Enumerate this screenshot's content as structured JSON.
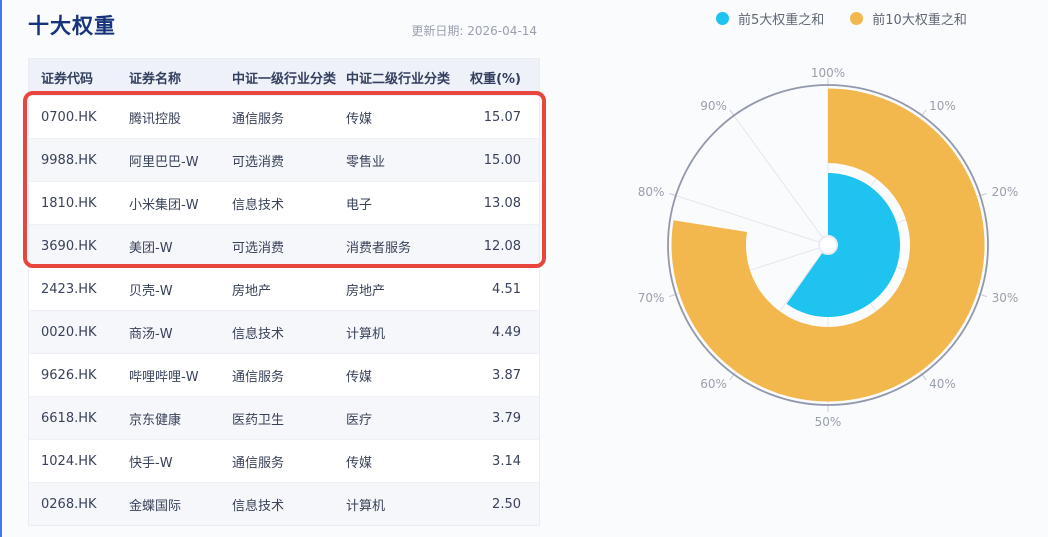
{
  "page": {
    "accent_color": "#4376f0",
    "background": "#fafbfd"
  },
  "header": {
    "title": "十大权重",
    "update_label": "更新日期: 2026-04-14"
  },
  "table": {
    "columns": [
      "证券代码",
      "证券名称",
      "中证一级行业分类",
      "中证二级行业分类",
      "权重(%)"
    ],
    "rows": [
      [
        "0700.HK",
        "腾讯控股",
        "通信服务",
        "传媒",
        "15.07"
      ],
      [
        "9988.HK",
        "阿里巴巴-W",
        "可选消费",
        "零售业",
        "15.00"
      ],
      [
        "1810.HK",
        "小米集团-W",
        "信息技术",
        "电子",
        "13.08"
      ],
      [
        "3690.HK",
        "美团-W",
        "可选消费",
        "消费者服务",
        "12.08"
      ],
      [
        "2423.HK",
        "贝壳-W",
        "房地产",
        "房地产",
        "4.51"
      ],
      [
        "0020.HK",
        "商汤-W",
        "信息技术",
        "计算机",
        "4.49"
      ],
      [
        "9626.HK",
        "哔哩哔哩-W",
        "通信服务",
        "传媒",
        "3.87"
      ],
      [
        "6618.HK",
        "京东健康",
        "医药卫生",
        "医疗",
        "3.79"
      ],
      [
        "1024.HK",
        "快手-W",
        "通信服务",
        "传媒",
        "3.14"
      ],
      [
        "0268.HK",
        "金蝶国际",
        "信息技术",
        "计算机",
        "2.50"
      ]
    ],
    "highlighted_row_count": 4,
    "highlight_color": "#e8463c"
  },
  "chart_data": {
    "type": "polar-gauge",
    "max": 100,
    "start": "top",
    "direction": "clockwise",
    "grid": true,
    "tick_step": 10,
    "tick_labels": [
      "10%",
      "20%",
      "30%",
      "40%",
      "50%",
      "60%",
      "70%",
      "80%",
      "90%",
      "100%"
    ],
    "legend_position": "top-right",
    "series": [
      {
        "name": "前5大权重之和",
        "value": 59.74,
        "color": "#1ec3ef",
        "ring": "inner"
      },
      {
        "name": "前10大权重之和",
        "value": 77.53,
        "color": "#f2b84e",
        "ring": "outer"
      }
    ]
  }
}
